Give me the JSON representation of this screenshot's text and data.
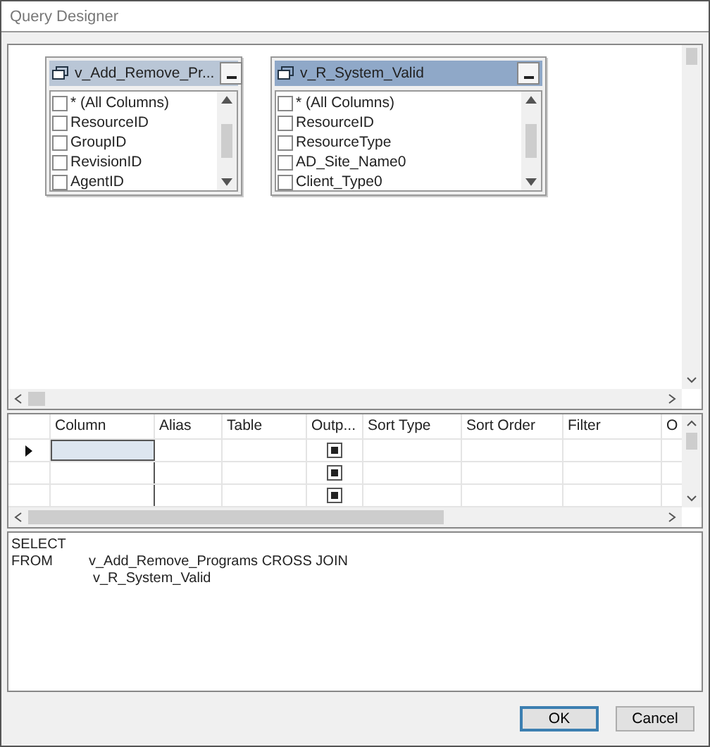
{
  "window": {
    "title": "Query Designer"
  },
  "diagram": {
    "tables": [
      {
        "title": "v_Add_Remove_Pr...",
        "selected": false,
        "columns": [
          {
            "name": "* (All Columns)",
            "checked": false
          },
          {
            "name": "ResourceID",
            "checked": false
          },
          {
            "name": "GroupID",
            "checked": false
          },
          {
            "name": "RevisionID",
            "checked": false
          },
          {
            "name": "AgentID",
            "checked": false
          }
        ]
      },
      {
        "title": "v_R_System_Valid",
        "selected": true,
        "columns": [
          {
            "name": "* (All Columns)",
            "checked": false
          },
          {
            "name": "ResourceID",
            "checked": false
          },
          {
            "name": "ResourceType",
            "checked": false
          },
          {
            "name": "AD_Site_Name0",
            "checked": false
          },
          {
            "name": "Client_Type0",
            "checked": false
          }
        ]
      }
    ]
  },
  "grid": {
    "columns": [
      "Column",
      "Alias",
      "Table",
      "Outp...",
      "Sort Type",
      "Sort Order",
      "Filter",
      "O"
    ],
    "rows": [
      {
        "current": true,
        "output": true
      },
      {
        "current": false,
        "output": true
      },
      {
        "current": false,
        "output": true
      }
    ]
  },
  "sql": {
    "lines": [
      {
        "keyword": "SELECT"
      },
      {
        "keyword": "FROM",
        "text": "v_Add_Remove_Programs CROSS JOIN"
      },
      {
        "text": "v_R_System_Valid"
      }
    ]
  },
  "buttons": [
    {
      "label": "OK",
      "default": true
    },
    {
      "label": "Cancel",
      "default": false
    }
  ]
}
